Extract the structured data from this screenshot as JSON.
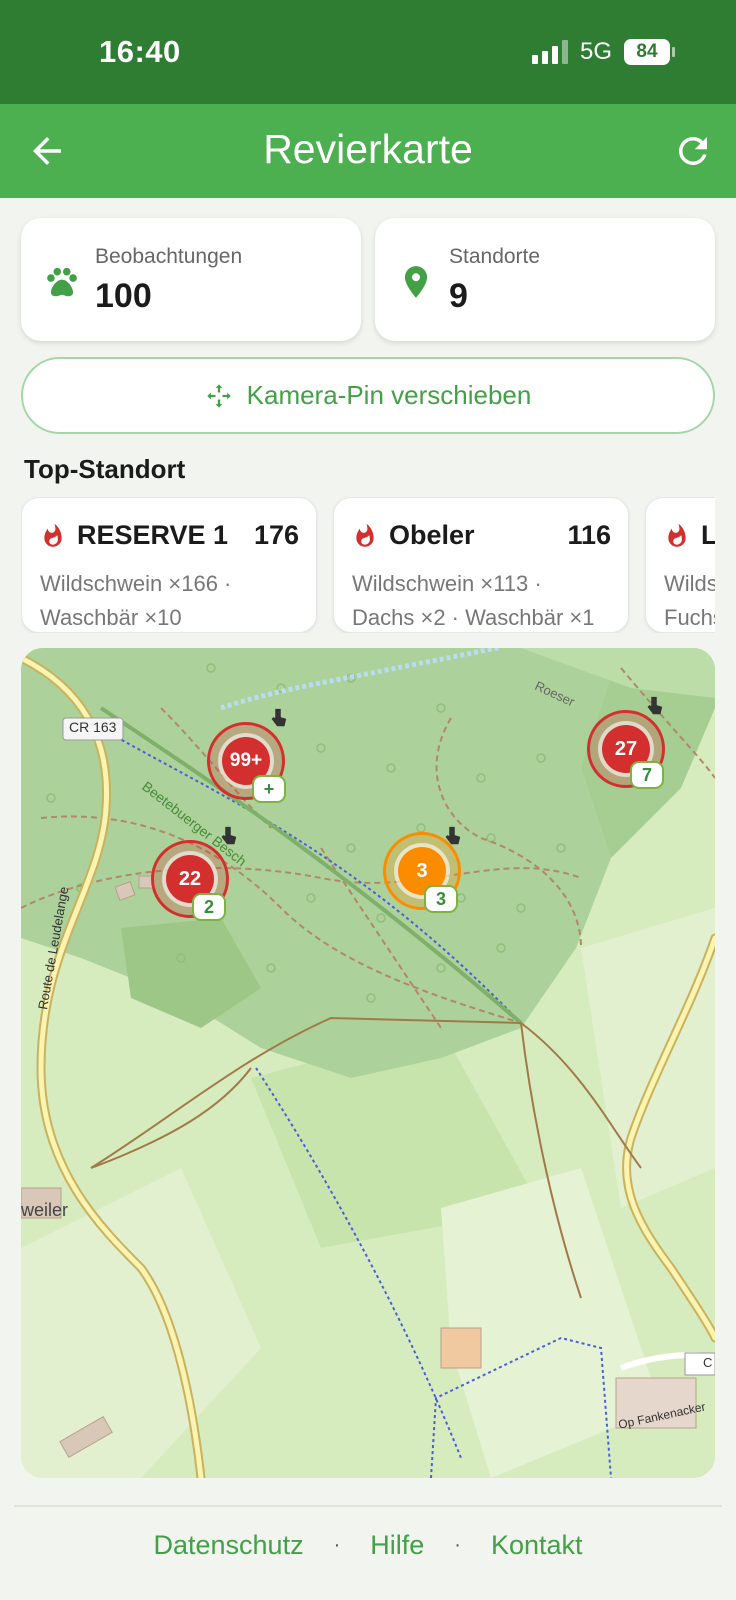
{
  "status_bar": {
    "time": "16:40",
    "network": "5G",
    "battery": "84"
  },
  "appbar": {
    "title": "Revierkarte",
    "back_icon": "arrow-left-icon",
    "refresh_icon": "refresh-icon"
  },
  "stats": [
    {
      "label": "Beobachtungen",
      "value": "100",
      "icon": "paw-icon"
    },
    {
      "label": "Standorte",
      "value": "9",
      "icon": "map-pin-icon"
    }
  ],
  "move_button": {
    "label": "Kamera-Pin verschieben",
    "icon": "move-arrows-icon"
  },
  "section_title": "Top-Standort",
  "top_locations": [
    {
      "name": "RESERVE 1",
      "count": "176",
      "line1": "Wildschwein ×166 ·",
      "line2": "Waschbär ×10"
    },
    {
      "name": "Obeler",
      "count": "116",
      "line1": "Wildschwein ×113 ·",
      "line2": "Dachs ×2 · Waschbär ×1"
    },
    {
      "name": "La",
      "count": "",
      "line1": "Wilds",
      "line2": "Fuchs"
    }
  ],
  "map": {
    "labels": {
      "road": "CR 163",
      "forest": "Beetebuerger Besch",
      "route": "Route de Leudelange",
      "roeser": "Roeser",
      "village": "weiler",
      "street": "Op Fankenacker",
      "edge": "C"
    },
    "clusters": [
      {
        "count": "99+",
        "badge": "+",
        "color": "#d32f2f"
      },
      {
        "count": "22",
        "badge": "2",
        "color": "#d32f2f"
      },
      {
        "count": "3",
        "badge": "3",
        "color": "#fb8c00"
      },
      {
        "count": "27",
        "badge": "7",
        "color": "#d32f2f"
      }
    ]
  },
  "footer": {
    "links": [
      "Datenschutz",
      "Hilfe",
      "Kontakt"
    ],
    "separator": "·"
  }
}
